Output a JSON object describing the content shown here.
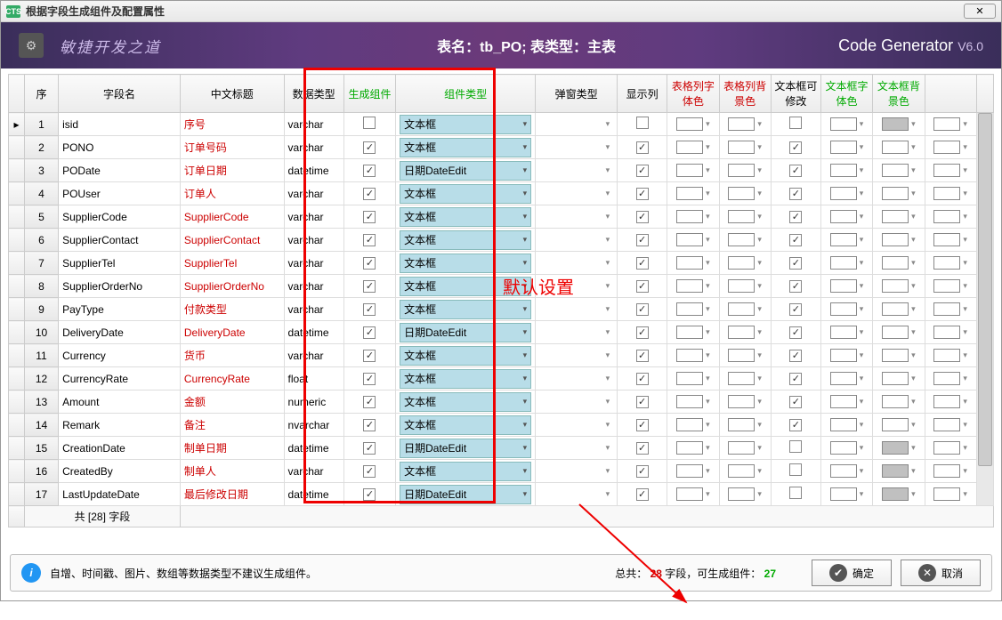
{
  "window": {
    "title": "根据字段生成组件及配置属性",
    "logo": "CTS"
  },
  "header": {
    "motto": "敏捷开发之道",
    "table_label": "表名：tb_PO;  表类型：主表",
    "brand": "Code Generator",
    "version": "V6.0"
  },
  "columns": {
    "seq": "序",
    "field": "字段名",
    "cn": "中文标题",
    "dtype": "数据类型",
    "gen": "生成组件",
    "ctype": "组件类型",
    "popup": "弹窗类型",
    "show": "显示列",
    "pc1": "表格列字体色",
    "pc2": "表格列背景色",
    "edit": "文本框可修改",
    "pc3": "文本框字体色",
    "pc4": "文本框背景色"
  },
  "rows": [
    {
      "n": 1,
      "field": "isid",
      "cn": "序号",
      "dt": "varchar",
      "gen": false,
      "ct": "文本框",
      "show": false,
      "edit": false,
      "gray": true
    },
    {
      "n": 2,
      "field": "PONO",
      "cn": "订单号码",
      "dt": "varchar",
      "gen": true,
      "ct": "文本框",
      "show": true,
      "edit": true,
      "gray": false
    },
    {
      "n": 3,
      "field": "PODate",
      "cn": "订单日期",
      "dt": "datetime",
      "gen": true,
      "ct": "日期DateEdit",
      "show": true,
      "edit": true,
      "gray": false
    },
    {
      "n": 4,
      "field": "POUser",
      "cn": "订单人",
      "dt": "varchar",
      "gen": true,
      "ct": "文本框",
      "show": true,
      "edit": true,
      "gray": false
    },
    {
      "n": 5,
      "field": "SupplierCode",
      "cn": "SupplierCode",
      "dt": "varchar",
      "gen": true,
      "ct": "文本框",
      "show": true,
      "edit": true,
      "gray": false
    },
    {
      "n": 6,
      "field": "SupplierContact",
      "cn": "SupplierContact",
      "dt": "varchar",
      "gen": true,
      "ct": "文本框",
      "show": true,
      "edit": true,
      "gray": false
    },
    {
      "n": 7,
      "field": "SupplierTel",
      "cn": "SupplierTel",
      "dt": "varchar",
      "gen": true,
      "ct": "文本框",
      "show": true,
      "edit": true,
      "gray": false
    },
    {
      "n": 8,
      "field": "SupplierOrderNo",
      "cn": "SupplierOrderNo",
      "dt": "varchar",
      "gen": true,
      "ct": "文本框",
      "show": true,
      "edit": true,
      "gray": false
    },
    {
      "n": 9,
      "field": "PayType",
      "cn": "付款类型",
      "dt": "varchar",
      "gen": true,
      "ct": "文本框",
      "show": true,
      "edit": true,
      "gray": false
    },
    {
      "n": 10,
      "field": "DeliveryDate",
      "cn": "DeliveryDate",
      "dt": "datetime",
      "gen": true,
      "ct": "日期DateEdit",
      "show": true,
      "edit": true,
      "gray": false
    },
    {
      "n": 11,
      "field": "Currency",
      "cn": "货币",
      "dt": "varchar",
      "gen": true,
      "ct": "文本框",
      "show": true,
      "edit": true,
      "gray": false
    },
    {
      "n": 12,
      "field": "CurrencyRate",
      "cn": "CurrencyRate",
      "dt": "float",
      "gen": true,
      "ct": "文本框",
      "show": true,
      "edit": true,
      "gray": false
    },
    {
      "n": 13,
      "field": "Amount",
      "cn": "金额",
      "dt": "numeric",
      "gen": true,
      "ct": "文本框",
      "show": true,
      "edit": true,
      "gray": false
    },
    {
      "n": 14,
      "field": "Remark",
      "cn": "备注",
      "dt": "nvarchar",
      "gen": true,
      "ct": "文本框",
      "show": true,
      "edit": true,
      "gray": false
    },
    {
      "n": 15,
      "field": "CreationDate",
      "cn": "制单日期",
      "dt": "datetime",
      "gen": true,
      "ct": "日期DateEdit",
      "show": true,
      "edit": false,
      "gray": true
    },
    {
      "n": 16,
      "field": "CreatedBy",
      "cn": "制单人",
      "dt": "varchar",
      "gen": true,
      "ct": "文本框",
      "show": true,
      "edit": false,
      "gray": true
    },
    {
      "n": 17,
      "field": "LastUpdateDate",
      "cn": "最后修改日期",
      "dt": "datetime",
      "gen": true,
      "ct": "日期DateEdit",
      "show": true,
      "edit": false,
      "gray": true
    }
  ],
  "footer_summary": "共 [28] 字段",
  "annotation": "默认设置",
  "bottom": {
    "hint": "自增、时间戳、图片、数组等数据类型不建议生成组件。",
    "stats_prefix": "总共：",
    "stats_total": "28",
    "stats_mid": " 字段，可生成组件：",
    "stats_gen": "27",
    "ok": "确定",
    "cancel": "取消"
  }
}
